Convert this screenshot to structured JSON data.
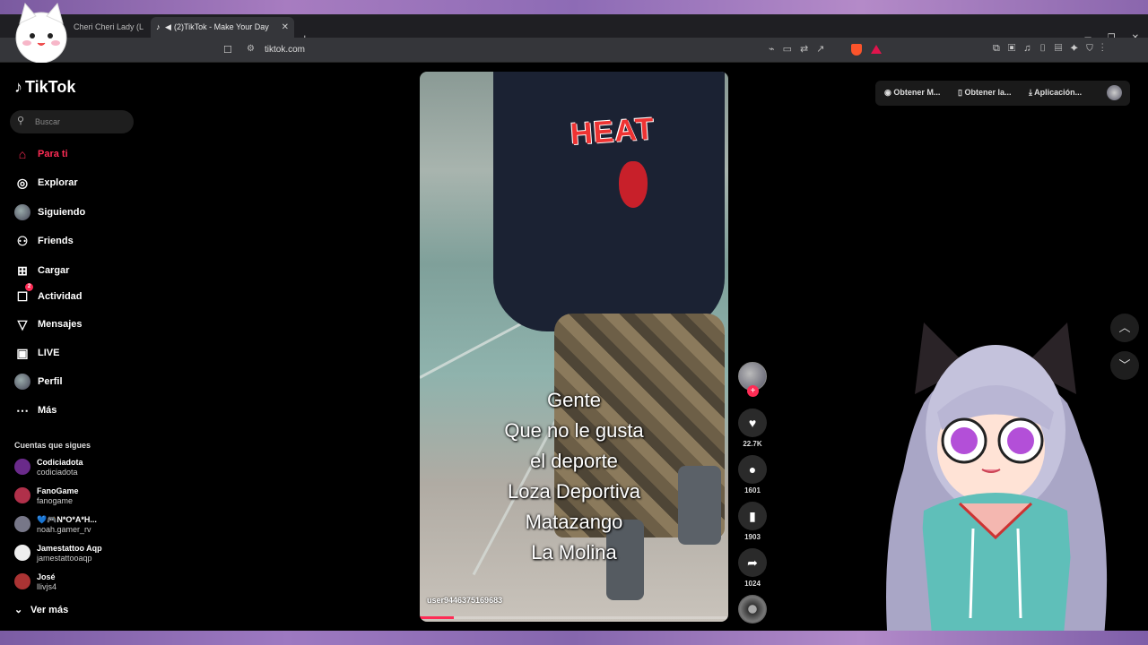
{
  "browser": {
    "tabs": [
      {
        "title": "Cheri Cheri Lady (L"
      },
      {
        "title": "(2)TikTok - Make Your Day"
      }
    ],
    "url": "tiktok.com"
  },
  "sidebar": {
    "logo": "TikTok",
    "search_placeholder": "Buscar",
    "nav": [
      {
        "label": "Para ti",
        "icon": "home-icon",
        "active": true
      },
      {
        "label": "Explorar",
        "icon": "compass-icon"
      },
      {
        "label": "Siguiendo",
        "icon": "avatar-icon"
      },
      {
        "label": "Friends",
        "icon": "friends-icon"
      },
      {
        "label": "Cargar",
        "icon": "upload-icon"
      },
      {
        "label": "Actividad",
        "icon": "activity-icon",
        "badge": "2"
      },
      {
        "label": "Mensajes",
        "icon": "send-icon"
      },
      {
        "label": "LIVE",
        "icon": "live-icon"
      },
      {
        "label": "Perfil",
        "icon": "profile-avatar-icon"
      },
      {
        "label": "Más",
        "icon": "more-icon"
      }
    ],
    "following_title": "Cuentas que sigues",
    "accounts": [
      {
        "name": "Codiciadota",
        "handle": "codiciadota"
      },
      {
        "name": "FanoGame",
        "handle": "fanogame"
      },
      {
        "name": "💙🎮N*O*A*H...",
        "handle": "noah.gamer_rv"
      },
      {
        "name": "Jamestattoo Aqp",
        "handle": "jamestattooaqp"
      },
      {
        "name": "José",
        "handle": "llivjs4"
      }
    ],
    "see_more": "Ver más"
  },
  "video": {
    "brand_text": "HEAT",
    "caption": [
      "Gente",
      "Que no le gusta",
      "el deporte",
      "Loza Deportiva",
      "Matazango",
      "La Molina"
    ],
    "username": "user9446375169683",
    "progress": 0.11
  },
  "actions": {
    "likes": "22.7K",
    "comments": "1601",
    "saves": "1903",
    "shares": "1024"
  },
  "top_actions": [
    "Obtener M...",
    "Obtener la...",
    "Aplicación..."
  ],
  "colors": {
    "accent": "#fe2c55",
    "background": "#000000",
    "chrome": "#35363a"
  }
}
